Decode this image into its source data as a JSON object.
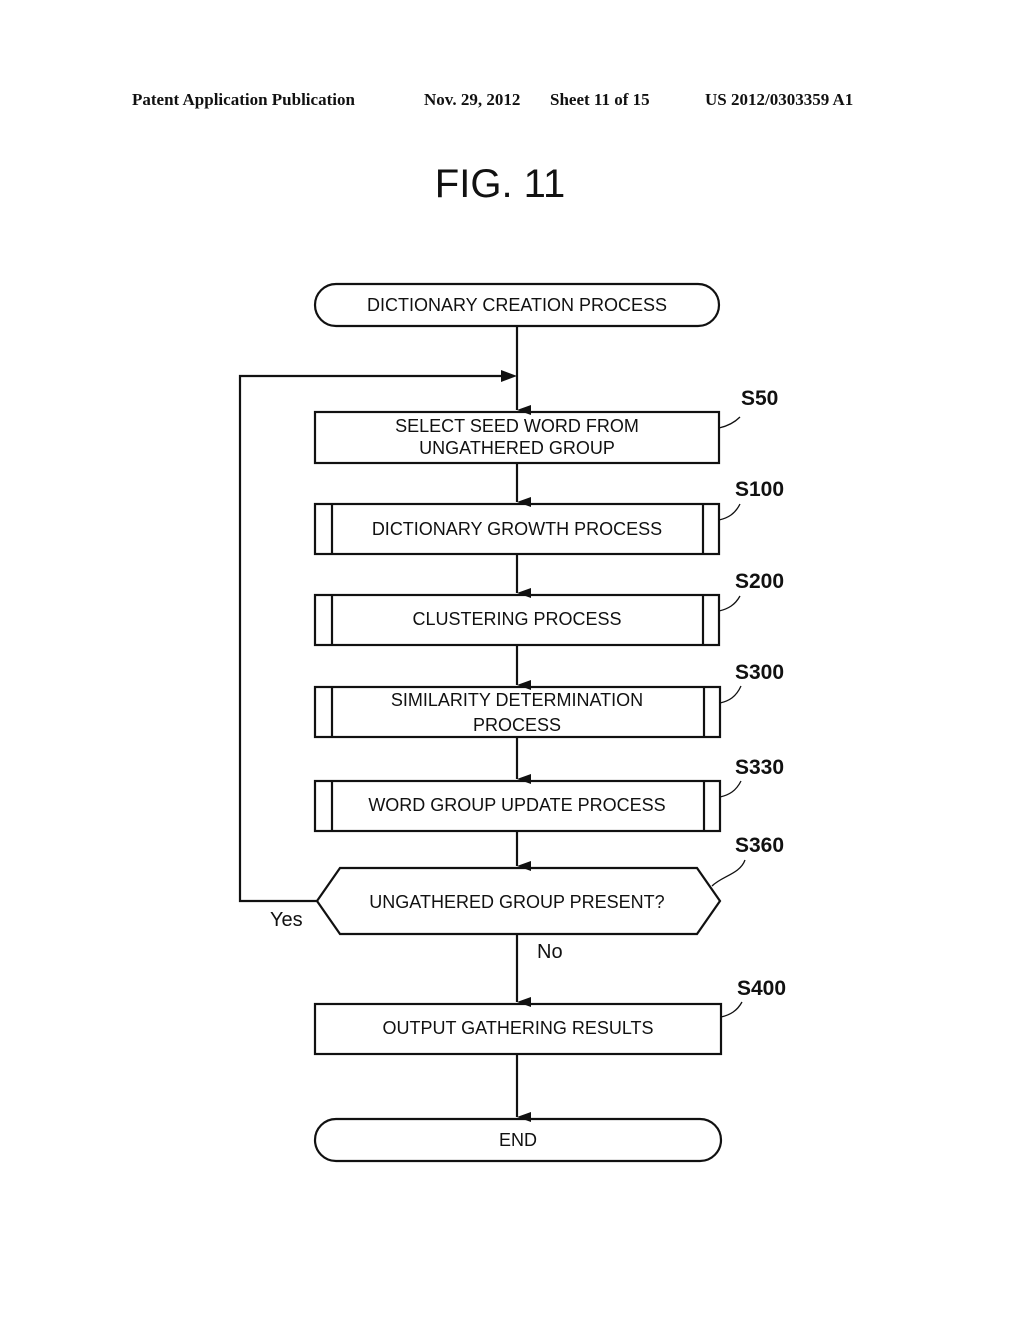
{
  "header": {
    "left": "Patent Application Publication",
    "date": "Nov. 29, 2012",
    "sheet": "Sheet 11 of 15",
    "number": "US 2012/0303359 A1"
  },
  "figure": {
    "title": "FIG. 11",
    "start": "DICTIONARY CREATION PROCESS",
    "steps": [
      {
        "id": "S50",
        "lines": [
          "SELECT SEED WORD FROM",
          "UNGATHERED GROUP"
        ],
        "type": "process"
      },
      {
        "id": "S100",
        "lines": [
          "DICTIONARY GROWTH PROCESS"
        ],
        "type": "subprocess"
      },
      {
        "id": "S200",
        "lines": [
          "CLUSTERING PROCESS"
        ],
        "type": "subprocess"
      },
      {
        "id": "S300",
        "lines": [
          "SIMILARITY DETERMINATION",
          "PROCESS"
        ],
        "type": "subprocess"
      },
      {
        "id": "S330",
        "lines": [
          "WORD GROUP UPDATE PROCESS"
        ],
        "type": "subprocess"
      },
      {
        "id": "S360",
        "lines": [
          "UNGATHERED GROUP PRESENT?"
        ],
        "type": "decision"
      },
      {
        "id": "S400",
        "lines": [
          "OUTPUT GATHERING RESULTS"
        ],
        "type": "process"
      }
    ],
    "yes_label": "Yes",
    "no_label": "No",
    "end": "END"
  }
}
